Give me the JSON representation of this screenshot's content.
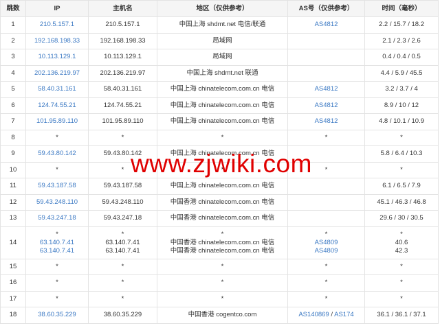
{
  "headers": [
    "跳数",
    "IP",
    "主机名",
    "地区（仅供参考）",
    "AS号（仅供参考）",
    "时间（毫秒）"
  ],
  "rows": [
    {
      "hop": "1",
      "ip": [
        "210.5.157.1"
      ],
      "host": [
        "210.5.157.1"
      ],
      "region": [
        "中国上海 shdmt.net 电信/联通"
      ],
      "as": [
        [
          "AS4812"
        ]
      ],
      "time": [
        "2.2 / 15.7 / 18.2"
      ]
    },
    {
      "hop": "2",
      "ip": [
        "192.168.198.33"
      ],
      "host": [
        "192.168.198.33"
      ],
      "region": [
        "局域网"
      ],
      "as": [
        []
      ],
      "time": [
        "2.1 / 2.3 / 2.6"
      ]
    },
    {
      "hop": "3",
      "ip": [
        "10.113.129.1"
      ],
      "host": [
        "10.113.129.1"
      ],
      "region": [
        "局域网"
      ],
      "as": [
        []
      ],
      "time": [
        "0.4 / 0.4 / 0.5"
      ]
    },
    {
      "hop": "4",
      "ip": [
        "202.136.219.97"
      ],
      "host": [
        "202.136.219.97"
      ],
      "region": [
        "中国上海 shdmt.net 联通"
      ],
      "as": [
        []
      ],
      "time": [
        "4.4 / 5.9 / 45.5"
      ]
    },
    {
      "hop": "5",
      "ip": [
        "58.40.31.161"
      ],
      "host": [
        "58.40.31.161"
      ],
      "region": [
        "中国上海 chinatelecom.com.cn 电信"
      ],
      "as": [
        [
          "AS4812"
        ]
      ],
      "time": [
        "3.2 / 3.7 / 4"
      ]
    },
    {
      "hop": "6",
      "ip": [
        "124.74.55.21"
      ],
      "host": [
        "124.74.55.21"
      ],
      "region": [
        "中国上海 chinatelecom.com.cn 电信"
      ],
      "as": [
        [
          "AS4812"
        ]
      ],
      "time": [
        "8.9 / 10 / 12"
      ]
    },
    {
      "hop": "7",
      "ip": [
        "101.95.89.110"
      ],
      "host": [
        "101.95.89.110"
      ],
      "region": [
        "中国上海 chinatelecom.com.cn 电信"
      ],
      "as": [
        [
          "AS4812"
        ]
      ],
      "time": [
        "4.8 / 10.1 / 10.9"
      ]
    },
    {
      "hop": "8",
      "ip": [
        "*"
      ],
      "host": [
        "*"
      ],
      "region": [
        "*"
      ],
      "as": [
        [
          "*"
        ]
      ],
      "time": [
        "*"
      ]
    },
    {
      "hop": "9",
      "ip": [
        "59.43.80.142"
      ],
      "host": [
        "59.43.80.142"
      ],
      "region": [
        "中国上海 chinatelecom.com.cn 电信"
      ],
      "as": [
        []
      ],
      "time": [
        "5.8 / 6.4 / 10.3"
      ]
    },
    {
      "hop": "10",
      "ip": [
        "*"
      ],
      "host": [
        "*"
      ],
      "region": [
        "*"
      ],
      "as": [
        [
          "*"
        ]
      ],
      "time": [
        "*"
      ]
    },
    {
      "hop": "11",
      "ip": [
        "59.43.187.58"
      ],
      "host": [
        "59.43.187.58"
      ],
      "region": [
        "中国上海 chinatelecom.com.cn 电信"
      ],
      "as": [
        []
      ],
      "time": [
        "6.1 / 6.5 / 7.9"
      ]
    },
    {
      "hop": "12",
      "ip": [
        "59.43.248.110"
      ],
      "host": [
        "59.43.248.110"
      ],
      "region": [
        "中国香港 chinatelecom.com.cn 电信"
      ],
      "as": [
        []
      ],
      "time": [
        "45.1 / 46.3 / 46.8"
      ]
    },
    {
      "hop": "13",
      "ip": [
        "59.43.247.18"
      ],
      "host": [
        "59.43.247.18"
      ],
      "region": [
        "中国香港 chinatelecom.com.cn 电信"
      ],
      "as": [
        []
      ],
      "time": [
        "29.6 / 30 / 30.5"
      ]
    },
    {
      "hop": "14",
      "ip": [
        "*",
        "63.140.7.41",
        "63.140.7.41"
      ],
      "host": [
        "*",
        "63.140.7.41",
        "63.140.7.41"
      ],
      "region": [
        "*",
        "中国香港 chinatelecom.com.cn 电信",
        "中国香港 chinatelecom.com.cn 电信"
      ],
      "as": [
        [
          "*"
        ],
        [
          "AS4809"
        ],
        [
          "AS4809"
        ]
      ],
      "time": [
        "*",
        "40.6",
        "42.3"
      ]
    },
    {
      "hop": "15",
      "ip": [
        "*"
      ],
      "host": [
        "*"
      ],
      "region": [
        "*"
      ],
      "as": [
        [
          "*"
        ]
      ],
      "time": [
        "*"
      ]
    },
    {
      "hop": "16",
      "ip": [
        "*"
      ],
      "host": [
        "*"
      ],
      "region": [
        "*"
      ],
      "as": [
        [
          "*"
        ]
      ],
      "time": [
        "*"
      ]
    },
    {
      "hop": "17",
      "ip": [
        "*"
      ],
      "host": [
        "*"
      ],
      "region": [
        "*"
      ],
      "as": [
        [
          "*"
        ]
      ],
      "time": [
        "*"
      ]
    },
    {
      "hop": "18",
      "ip": [
        "38.60.35.229"
      ],
      "host": [
        "38.60.35.229"
      ],
      "region": [
        "中国香港 cogentco.com"
      ],
      "as": [
        [
          "AS140869",
          "AS174"
        ]
      ],
      "time": [
        "36.1 / 36.1 / 37.1"
      ]
    }
  ],
  "as_separator": " / ",
  "watermark": "www.zjwiki.com",
  "colors": {
    "link": "#3a78c3",
    "header_bg": "#f5f5f5",
    "border": "#e3e3e3",
    "watermark": "#e00000"
  }
}
